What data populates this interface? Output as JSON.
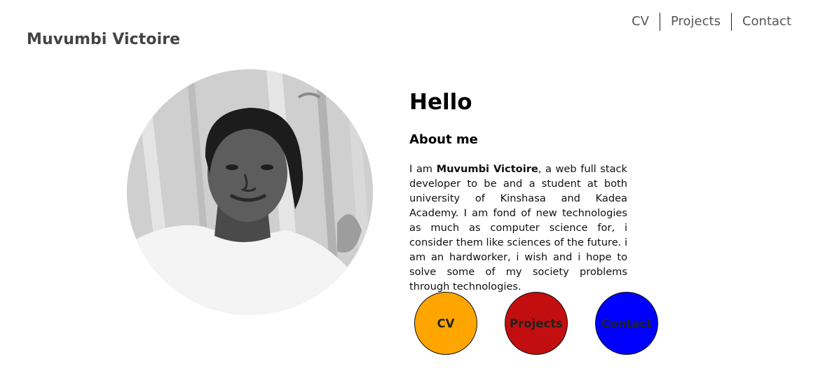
{
  "header": {
    "site_title": "Muvumbi Victoire",
    "nav": [
      {
        "label": "CV"
      },
      {
        "label": "Projects"
      },
      {
        "label": "Contact"
      }
    ]
  },
  "main": {
    "greeting": "Hello",
    "about_heading": "About me",
    "bio": {
      "prefix": "I am ",
      "name": "Muvumbi Victoire",
      "text": ", a web full stack developer to be and a student at both university of Kinshasa and Kadea Academy. I am fond of new technologies as much as computer science for, i consider them like sciences of the future. i am an hardworker, i wish and i hope to solve some of my society problems through technologies."
    },
    "photo": {
      "icon": "profile-photo"
    },
    "buttons": [
      {
        "label": "CV",
        "color": "#FFA500"
      },
      {
        "label": "Projects",
        "color": "#C20E0E"
      },
      {
        "label": "Contact",
        "color": "#0000FF"
      }
    ]
  }
}
